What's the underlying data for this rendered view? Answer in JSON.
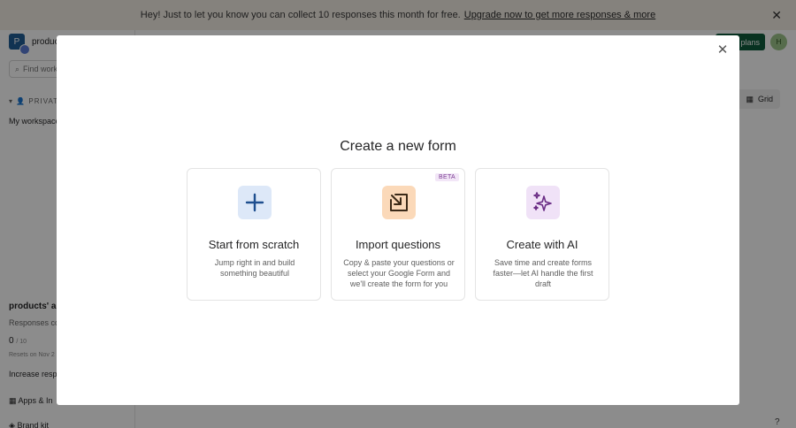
{
  "banner": {
    "text": "Hey! Just to let you know you can collect 10 responses this month for free.",
    "link": "Upgrade now to get more responses & more",
    "close_icon": "close-icon"
  },
  "sidebar": {
    "workspace_initial": "P",
    "workspace_name": "produc",
    "find_placeholder": "Find worksp",
    "private_label": "PRIVAT",
    "my_workspace": "My workspace",
    "usage_title": "products' ac",
    "usage_sub": "Responses co",
    "usage_count": "0",
    "usage_limit": "/ 10",
    "usage_reset": "Resets on Nov 2",
    "increase": "Increase respo",
    "apps": "Apps & In",
    "brand": "Brand kit"
  },
  "header": {
    "plans_label": "plans",
    "user_initials": "H"
  },
  "toolbar": {
    "grid_label": "Grid",
    "help": "?"
  },
  "modal": {
    "title": "Create a new form",
    "close_icon": "close-icon",
    "cards": [
      {
        "title": "Start from scratch",
        "desc": "Jump right in and build something beautiful",
        "icon": "plus-icon",
        "icon_bg": "#dde8f8",
        "icon_color": "#1f4f8f"
      },
      {
        "title": "Import questions",
        "desc": "Copy & paste your questions or select your Google Form and we'll create the form for you",
        "icon": "import-arrow-icon",
        "icon_bg": "#fbd9b9",
        "icon_color": "#3b2a18",
        "badge": "BETA"
      },
      {
        "title": "Create with AI",
        "desc": "Save time and create forms faster—let AI handle the first draft",
        "icon": "sparkles-icon",
        "icon_bg": "#f0e2f7",
        "icon_color": "#6a2d85"
      }
    ]
  }
}
